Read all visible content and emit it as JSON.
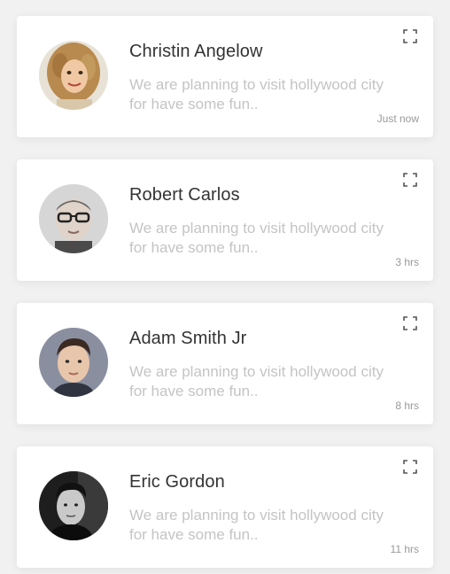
{
  "messages": [
    {
      "name": "Christin Angelow",
      "text": "We are planning to visit hollywood city for have some fun..",
      "time": "Just now",
      "avatar": "woman-curly-hair-avatar"
    },
    {
      "name": "Robert Carlos",
      "text": "We are planning to visit hollywood city for have some fun..",
      "time": "3 hrs",
      "avatar": "man-glasses-avatar"
    },
    {
      "name": "Adam Smith Jr",
      "text": "We are planning to visit hollywood city for have some fun..",
      "time": "8 hrs",
      "avatar": "young-man-avatar"
    },
    {
      "name": "Eric Gordon",
      "text": "We are planning to visit hollywood city for have some fun..",
      "time": "11 hrs",
      "avatar": "man-bw-portrait-avatar"
    }
  ],
  "icons": {
    "expand": "expand-icon"
  },
  "colors": {
    "background": "#f1f1f1",
    "card": "#ffffff",
    "name": "#333333",
    "message": "#c4c4c4",
    "time": "#9a9a9a"
  }
}
